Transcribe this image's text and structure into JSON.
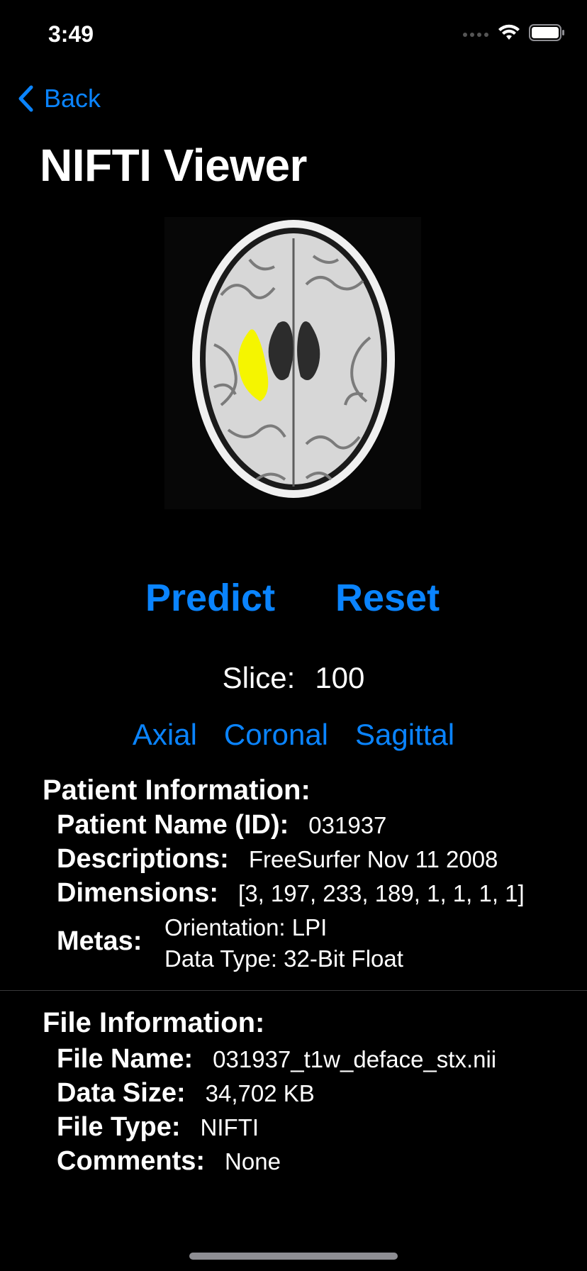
{
  "status_bar": {
    "time": "3:49"
  },
  "nav": {
    "back_label": "Back"
  },
  "title": "NIFTI Viewer",
  "actions": {
    "predict_label": "Predict",
    "reset_label": "Reset"
  },
  "slice": {
    "label": "Slice:",
    "value": "100"
  },
  "planes": [
    "Axial",
    "Coronal",
    "Sagittal"
  ],
  "patient_info": {
    "title": "Patient Information:",
    "name_label": "Patient Name (ID):",
    "name_value": "031937",
    "descriptions_label": "Descriptions:",
    "descriptions_value": "FreeSurfer Nov 11 2008",
    "dimensions_label": "Dimensions:",
    "dimensions_value": "[3, 197, 233, 189, 1, 1, 1, 1]",
    "metas_label": "Metas:",
    "metas_values": [
      "Orientation: LPI",
      "Data Type: 32-Bit Float"
    ]
  },
  "file_info": {
    "title": "File Information:",
    "file_name_label": "File Name:",
    "file_name_value": "031937_t1w_deface_stx.nii",
    "data_size_label": "Data Size:",
    "data_size_value": "34,702 KB",
    "file_type_label": "File Type:",
    "file_type_value": "NIFTI",
    "comments_label": "Comments:",
    "comments_value": "None"
  },
  "colors": {
    "accent": "#0a84ff",
    "background": "#000000",
    "segmentation": "#f5f500"
  },
  "icons": [
    "cellular-signal-icon",
    "wifi-icon",
    "battery-icon",
    "chevron-left-icon"
  ]
}
